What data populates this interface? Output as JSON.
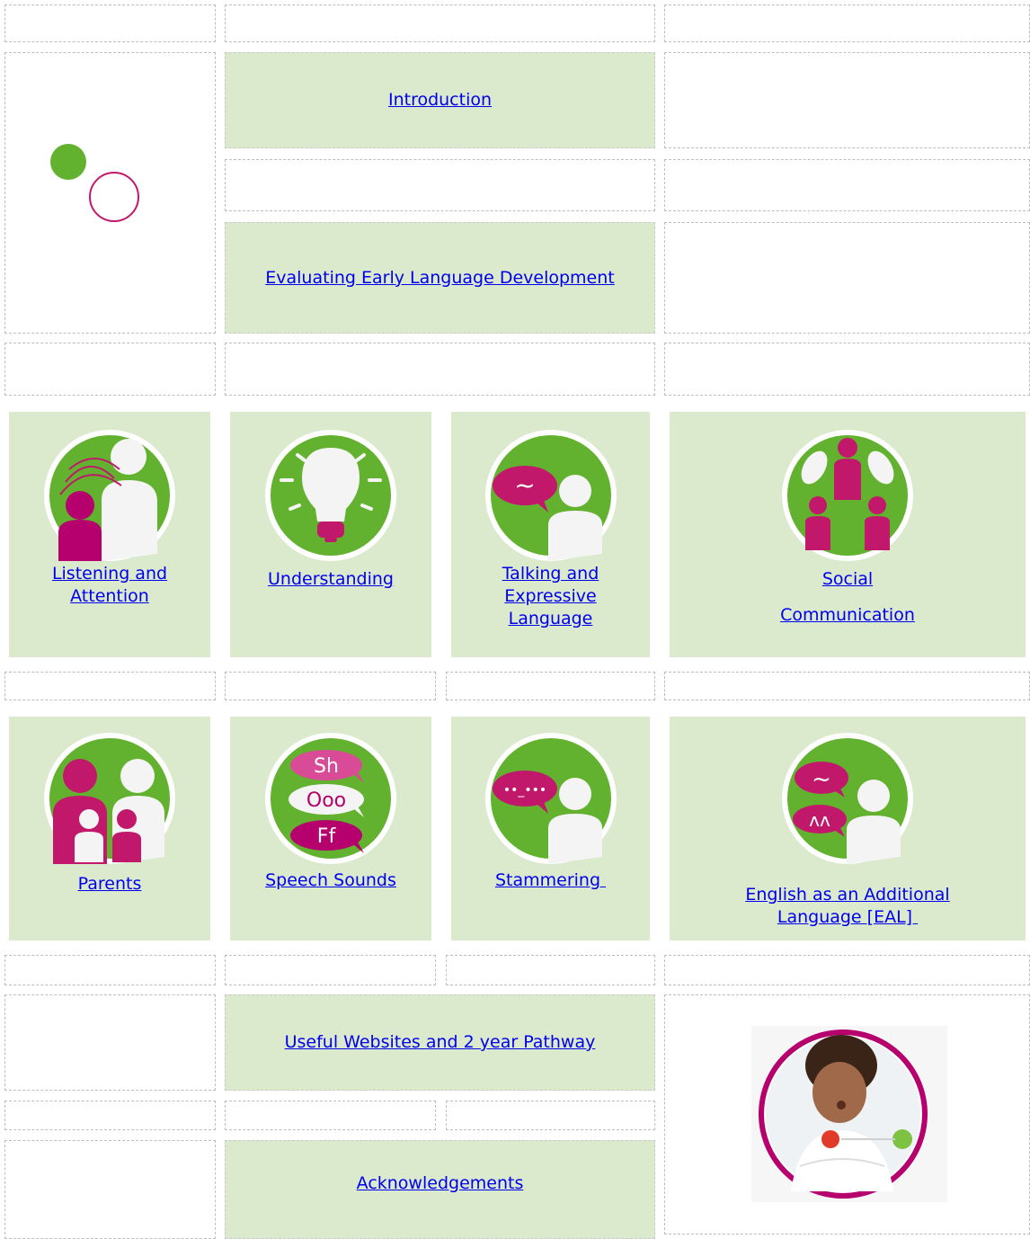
{
  "links": {
    "introduction": "Introduction",
    "evaluating": "Evaluating Early Language Development",
    "useful_websites": "Useful Websites and 2 year Pathway",
    "acknowledgements": "Acknowledgements"
  },
  "tiles_row1": [
    {
      "lines": [
        "Listening and",
        "Attention"
      ],
      "icon": "listening-icon"
    },
    {
      "lines": [
        "Understanding"
      ],
      "icon": "lightbulb-icon"
    },
    {
      "lines": [
        "Talking and ",
        "Expressive",
        "Language"
      ],
      "icon": "talking-icon"
    },
    {
      "lines": [
        "Social",
        "Communication"
      ],
      "icon": "social-group-icon"
    }
  ],
  "tiles_row2": [
    {
      "lines": [
        "Parents"
      ],
      "icon": "family-icon"
    },
    {
      "lines": [
        "Speech Sounds"
      ],
      "icon": "speech-sounds-icon"
    },
    {
      "lines": [
        "Stammering "
      ],
      "icon": "stammering-icon"
    },
    {
      "lines": [
        "English as an Additional",
        "Language [EAL] "
      ],
      "icon": "eal-icon"
    }
  ],
  "icon_text": {
    "sh": "Sh",
    "ooo": "Ooo",
    "ff": "Ff",
    "tilde": "~",
    "dots": "••_•••",
    "caret": "ʌʌ"
  },
  "colors": {
    "tile_green": "#dbe9cd",
    "accent_green": "#62b22f",
    "accent_magenta": "#b5006d"
  }
}
